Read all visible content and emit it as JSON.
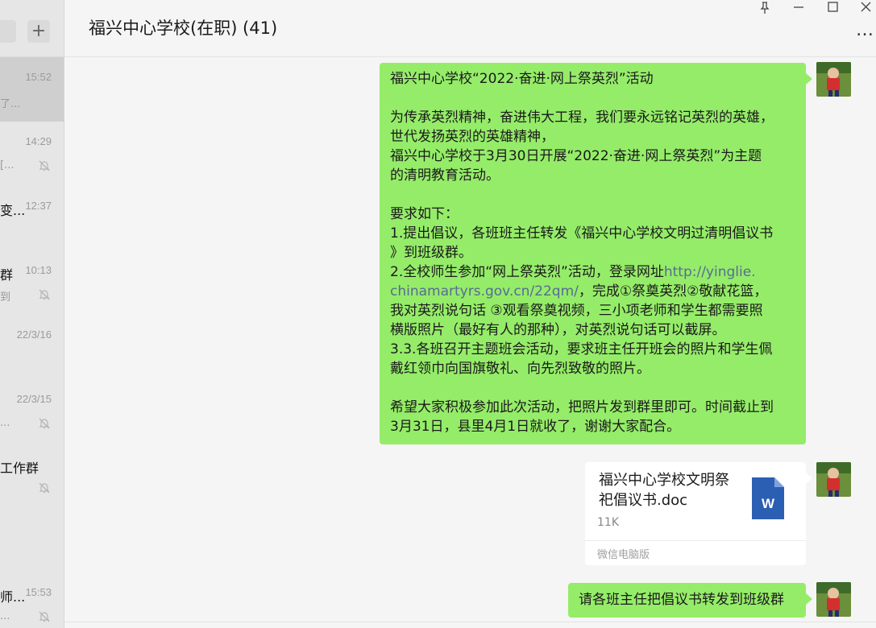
{
  "sidebar": {
    "add_label": "+",
    "chats": [
      {
        "title": "",
        "preview": "了...",
        "time": "15:52",
        "muted": false,
        "selected": true
      },
      {
        "title": "",
        "preview": "[...",
        "time": "14:29",
        "muted": true,
        "selected": false
      },
      {
        "title": "变...",
        "preview": "",
        "time": "12:37",
        "muted": false,
        "selected": false
      },
      {
        "title": "群",
        "preview": "到",
        "time": "10:13",
        "muted": true,
        "selected": false
      },
      {
        "title": "",
        "preview": "",
        "time": "22/3/16",
        "muted": false,
        "selected": false
      },
      {
        "title": "",
        "preview": "...",
        "time": "22/3/15",
        "muted": true,
        "selected": false
      },
      {
        "title": "工作群",
        "preview": "",
        "time": "",
        "muted": true,
        "selected": false
      },
      {
        "title": "",
        "preview": "",
        "time": "",
        "muted": false,
        "selected": false
      },
      {
        "title": "师...",
        "preview": "...",
        "time": "15:53",
        "muted": true,
        "selected": false
      }
    ]
  },
  "header": {
    "title": "福兴中心学校(在职) (41)",
    "more_label": "…"
  },
  "messages": {
    "announcement": {
      "lines": [
        "福兴中心学校“2022·奋进·网上祭英烈”活动",
        "",
        "为传承英烈精神，奋进伟大工程，我们要永远铭记英烈的英雄，",
        "世代发扬英烈的英雄精神，",
        "福兴中心学校于3月30日开展“2022·奋进·网上祭英烈”为主题",
        "的清明教育活动。",
        "",
        "要求如下：",
        "1.提出倡议，各班班主任转发《福兴中心学校文明过清明倡议书",
        "》到班级群。"
      ],
      "req2_prefix": "2.全校师生参加“网上祭英烈”活动，登录网址",
      "link_part1": "http://yinglie.",
      "link_part2": "chinamartyrs.gov.cn/22qm/",
      "req2_suffix": "，完成①祭奠英烈②敬献花篮，",
      "lines_after": [
        "我对英烈说句话 ③观看祭奠视频，三小项老师和学生都需要照",
        "横版照片（最好有人的那种），对英烈说句话可以截屏。",
        "3.3.各班召开主题班会活动，要求班主任开班会的照片和学生佩",
        "戴红领巾向国旗敬礼、向先烈致敬的照片。",
        "",
        "希望大家积极参加此次活动，把照片发到群里即可。时间截止到",
        "3月31日，县里4月1日就收了，谢谢大家配合。"
      ]
    },
    "file": {
      "name_line1": "福兴中心学校文明祭",
      "name_line2": "祀倡议书.doc",
      "size": "11K",
      "source": "微信电脑版",
      "icon_letter": "W"
    },
    "last": {
      "text": "请各班主任把倡议书转发到班级群"
    }
  },
  "colors": {
    "bubble_green": "#95ec69",
    "link": "#576b95",
    "word_blue": "#2b5fb3"
  }
}
